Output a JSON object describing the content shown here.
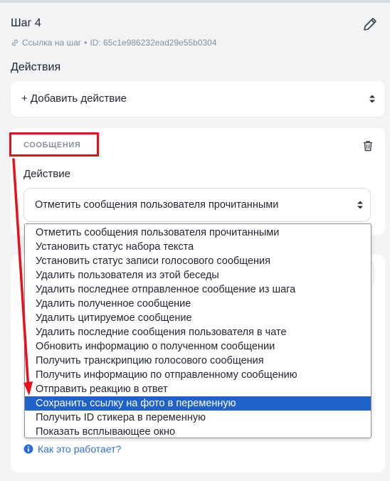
{
  "step": {
    "title": "Шаг 4",
    "link_label": "Ссылка на шаг",
    "separator": "•",
    "id_text": "ID: 65c1e986232ead29e55b0304"
  },
  "actions": {
    "section_label": "Действия",
    "add_action_label": "+ Добавить действие"
  },
  "messages_block": {
    "badge": "СООБЩЕНИЯ",
    "field_label": "Действие",
    "selected_value": "Отметить сообщения пользователя прочитанными",
    "options": [
      "Отметить сообщения пользователя прочитанными",
      "Установить статус набора текста",
      "Установить статус записи голосового сообщения",
      "Удалить пользователя из этой беседы",
      "Удалить последнее отправленное сообщение из шага",
      "Удалить полученное сообщение",
      "Удалить цитируемое сообщение",
      "Удалить последние сообщения пользователя в чате",
      "Обновить информацию о полученном сообщении",
      "Получить транскрипцию голосового сообщения",
      "Получить информацию по отправленному сообщению",
      "Отправить реакцию в ответ",
      "Сохранить ссылку на фото в переменную",
      "Получить ID стикера в переменную",
      "Показать всплывающее окно"
    ],
    "highlighted_option": "Сохранить ссылку на фото в переменную"
  },
  "help": {
    "how_it_works": "Как это работает?"
  },
  "colors": {
    "highlight": "#1f62cc",
    "annotation_red": "#e8101a",
    "link_blue": "#2f6fd1"
  },
  "icons": [
    "pencil-icon",
    "link-icon",
    "updown-chevron-icon",
    "trash-icon",
    "info-icon"
  ]
}
